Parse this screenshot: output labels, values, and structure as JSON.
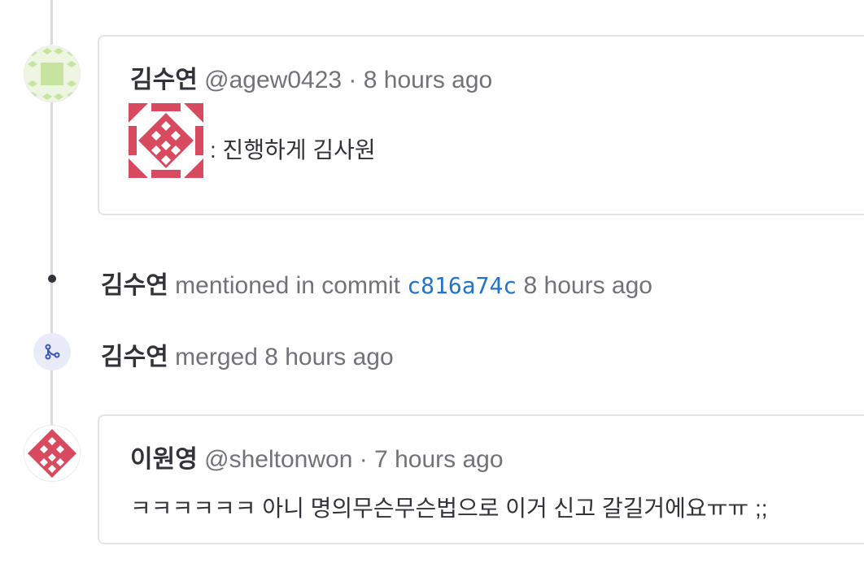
{
  "note1": {
    "author": "김수연",
    "handle": "@agew0423",
    "separator": "·",
    "time": "8 hours ago",
    "body": ": 진행하게 김사원",
    "emoji_icon": "pattern-avatar-emoji"
  },
  "event_commit": {
    "author": "김수연",
    "action": "mentioned in commit",
    "commit": "c816a74c",
    "time": "8 hours ago"
  },
  "event_merge": {
    "author": "김수연",
    "action": "merged",
    "time": "8 hours ago",
    "icon": "merge-icon"
  },
  "note2": {
    "author": "이원영",
    "handle": "@sheltonwon",
    "separator": "·",
    "time": "7 hours ago",
    "body": "ㅋㅋㅋㅋㅋㅋ 아니 명의무슨무슨법으로 이거 신고 갈길거에요ㅠㅠ ;;"
  },
  "colors": {
    "link": "#1f75cb",
    "avatar_red": "#d84a5f",
    "avatar_green": "#c6e3a0",
    "merge_badge_bg": "#e9ebf8"
  }
}
